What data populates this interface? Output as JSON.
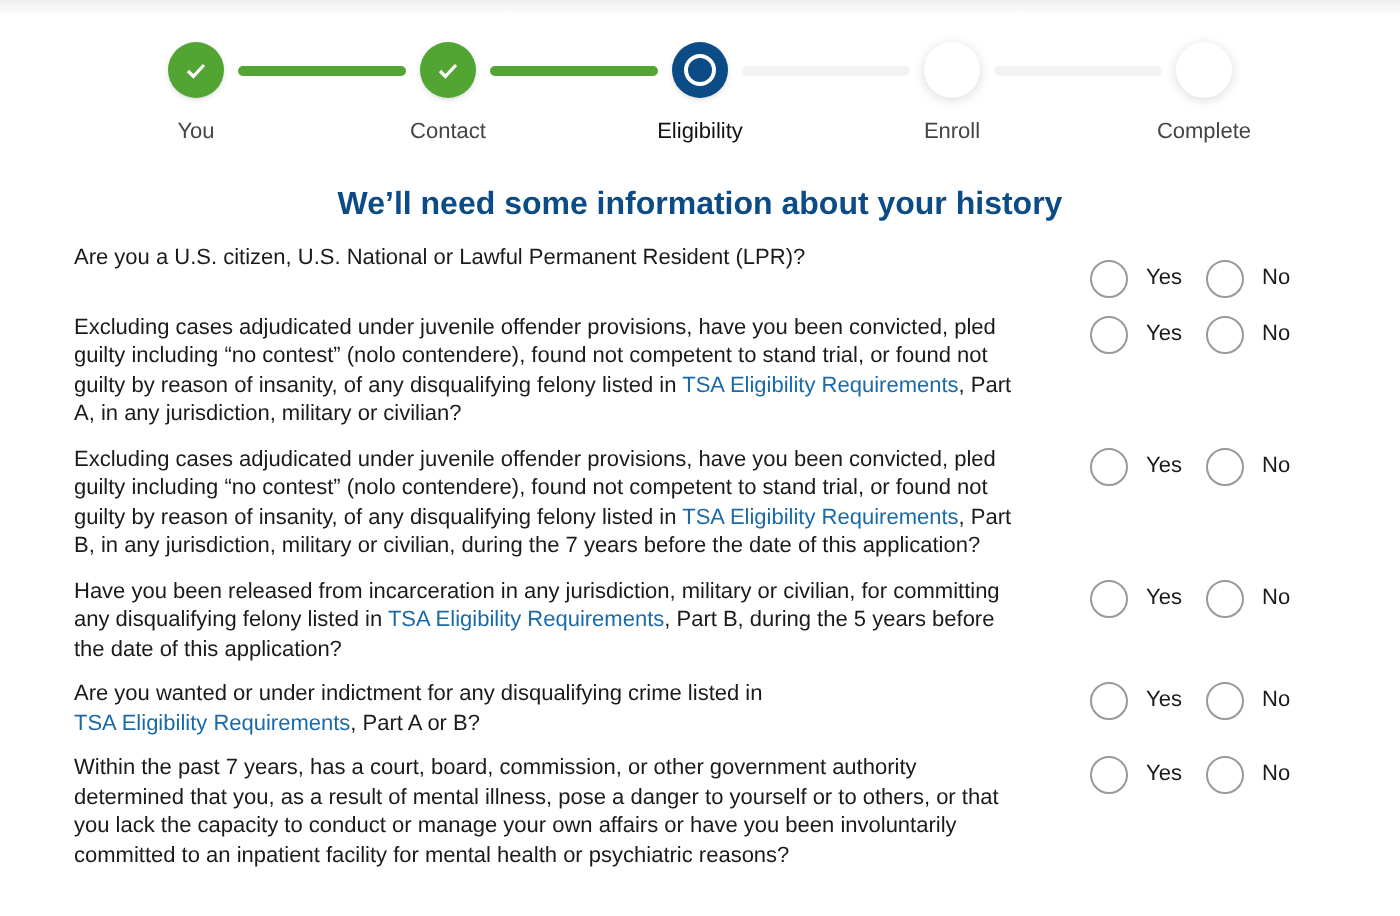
{
  "steps": [
    {
      "label": "You",
      "kind": "done"
    },
    {
      "label": "Contact",
      "kind": "done"
    },
    {
      "label": "Eligibility",
      "kind": "current"
    },
    {
      "label": "Enroll",
      "kind": "todo"
    },
    {
      "label": "Complete",
      "kind": "todo"
    }
  ],
  "heading": "We’ll need some information about your history",
  "questions": [
    {
      "text": [
        "Are you a U.S. citizen, U.S. National or Lawful Permanent Resident (LPR)?"
      ],
      "options": [
        {
          "label": "Yes",
          "selected": false
        },
        {
          "label": "No",
          "selected": false
        }
      ]
    },
    {
      "text": [
        "Excluding cases adjudicated under juvenile offender provisions, have you been convicted, pled guilty including “no contest” (nolo contendere), found not competent to stand trial, or found not guilty by reason of insanity, of any disqualifying felony listed in ",
        "TSA Eligibility Requirements",
        ", Part A, in any jurisdiction, military or civilian?"
      ],
      "options": [
        {
          "label": "Yes",
          "selected": false
        },
        {
          "label": "No",
          "selected": false
        }
      ]
    },
    {
      "text": [
        "Excluding cases adjudicated under juvenile offender provisions, have you been convicted, pled guilty including “no contest” (nolo contendere), found not competent to stand trial, or found not guilty by reason of insanity, of any disqualifying felony listed in ",
        "TSA Eligibility Requirements",
        ", Part B, in any jurisdiction, military or civilian, during the 7 years before the date of this application?"
      ],
      "options": [
        {
          "label": "Yes",
          "selected": false
        },
        {
          "label": "No",
          "selected": false
        }
      ]
    },
    {
      "text": [
        "Have you been released from incarceration in any jurisdiction, military or civilian, for committing any disqualifying felony listed in ",
        "TSA Eligibility Requirements",
        ", Part B, during the 5 years before the date of this application?"
      ],
      "options": [
        {
          "label": "Yes",
          "selected": false
        },
        {
          "label": "No",
          "selected": false
        }
      ]
    },
    {
      "text": [
        "Are you wanted or under indictment for any disqualifying crime listed in ",
        "TSA Eligibility Requirements",
        ", Part A or B?"
      ],
      "options": [
        {
          "label": "Yes",
          "selected": false
        },
        {
          "label": "No",
          "selected": false
        }
      ]
    },
    {
      "text": [
        "Within the past 7 years, has a court, board, commission, or other government authority determined that you, as a result of mental illness, pose a danger to yourself or to others, or that you lack the capacity to conduct or manage your own affairs or have you been involuntarily committed to an inpatient facility for mental health or psychiatric reasons?"
      ],
      "options": [
        {
          "label": "Yes",
          "selected": false
        },
        {
          "label": "No",
          "selected": false
        }
      ]
    }
  ]
}
